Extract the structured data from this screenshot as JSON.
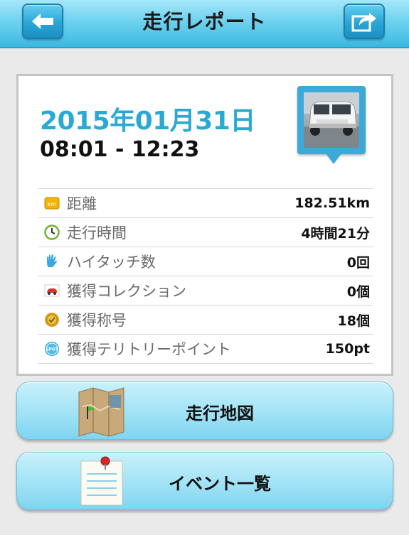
{
  "header": {
    "title": "走行レポート",
    "back_icon": "arrow-left-icon",
    "share_icon": "share-icon"
  },
  "report": {
    "date": "2015年01月31日",
    "time_range": "08:01 - 12:23",
    "thumbnail": "car-photo",
    "rows": [
      {
        "icon": "km-icon",
        "label": "距離",
        "value": "182.51km"
      },
      {
        "icon": "clock-icon",
        "label": "走行時間",
        "value": "4時間21分"
      },
      {
        "icon": "hand-icon",
        "label": "ハイタッチ数",
        "value": "0回"
      },
      {
        "icon": "car-icon",
        "label": "獲得コレクション",
        "value": "0個"
      },
      {
        "icon": "medal-icon",
        "label": "獲得称号",
        "value": "18個"
      },
      {
        "icon": "spot-icon",
        "label": "獲得テリトリーポイント",
        "value": "150pt"
      }
    ]
  },
  "buttons": {
    "map_label": "走行地図",
    "events_label": "イベント一覧"
  },
  "icon_text": {
    "km": "km",
    "spot": "SPOT"
  },
  "colors": {
    "accent": "#2aa9d2",
    "header": "#6fd2ef"
  }
}
